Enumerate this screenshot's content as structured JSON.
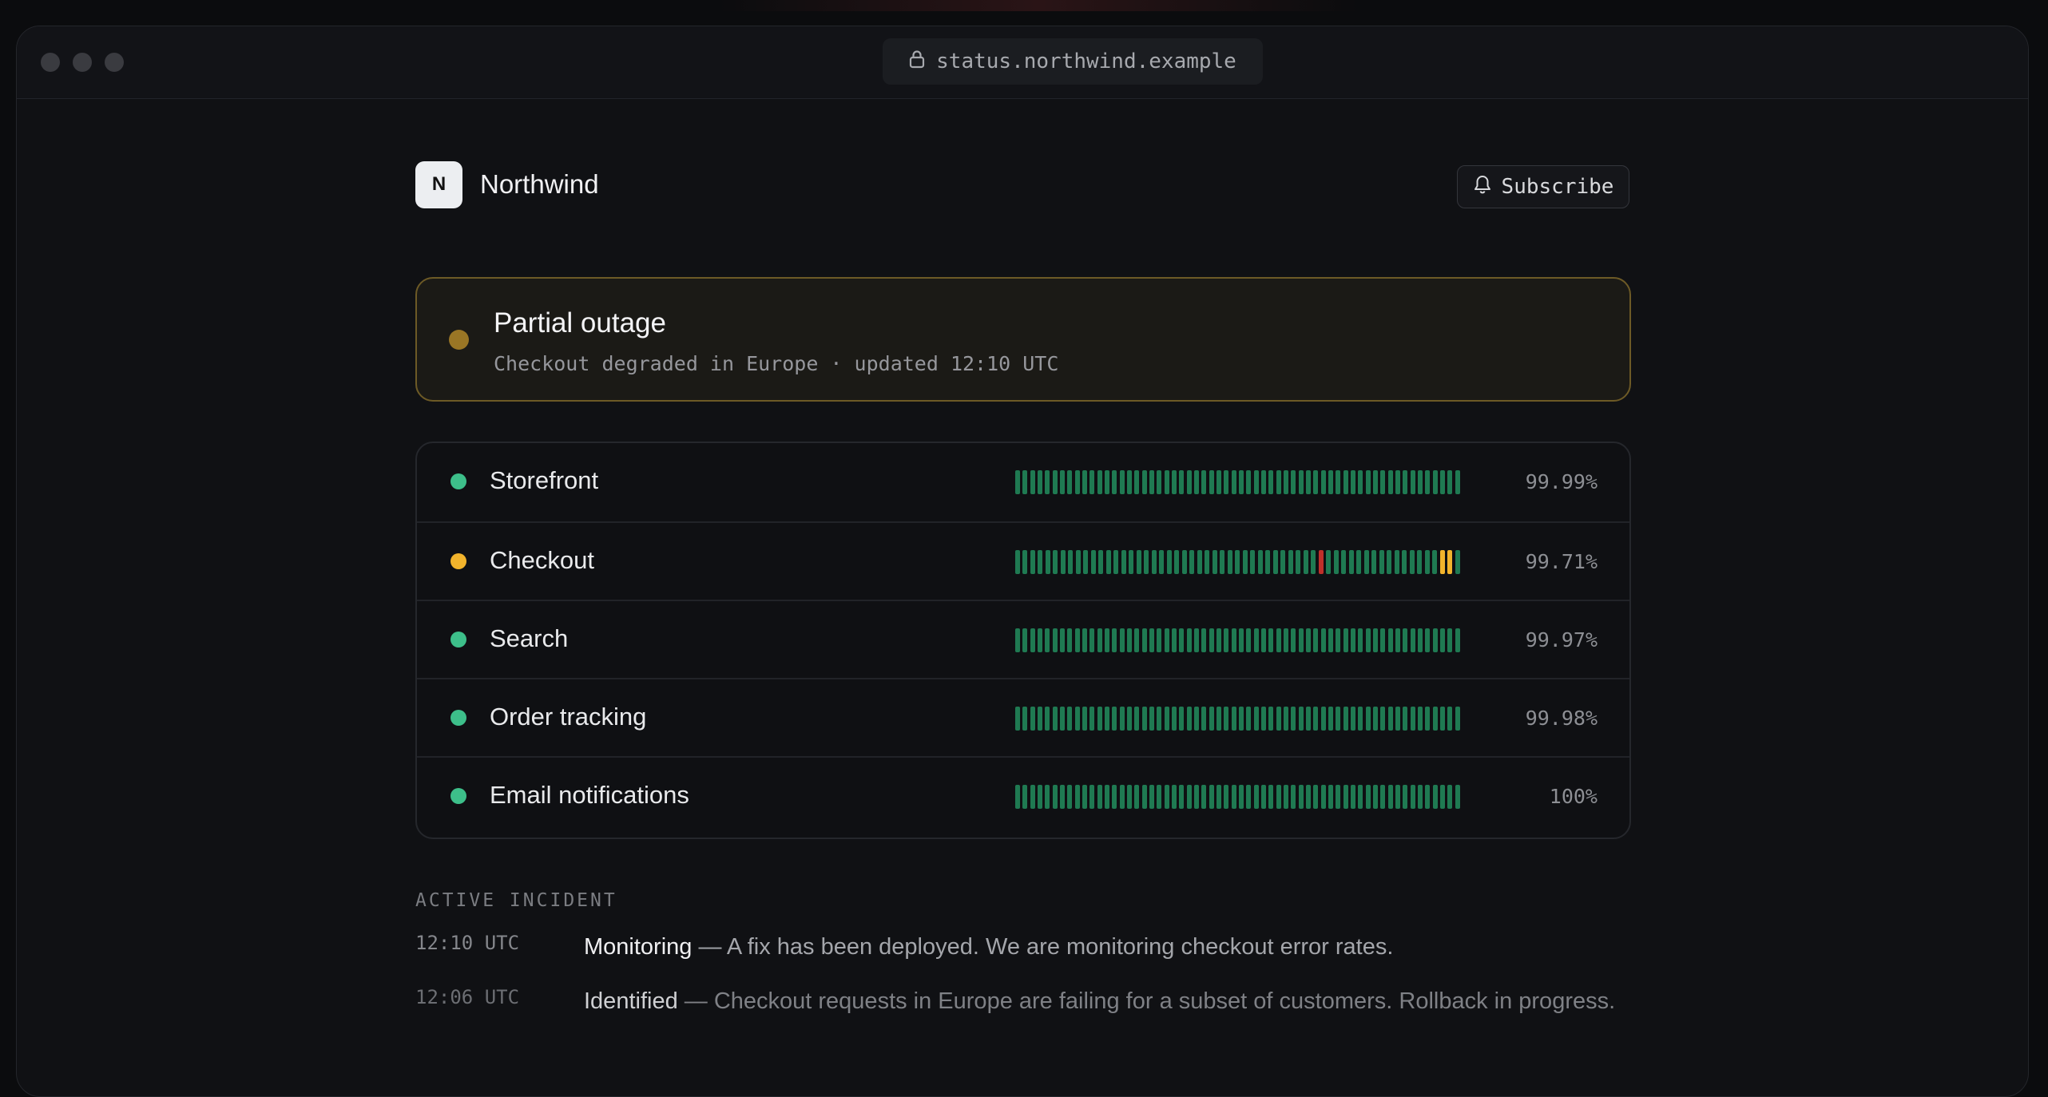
{
  "browser": {
    "url": "status.northwind.example"
  },
  "brand": {
    "logo_letter": "N",
    "name": "Northwind"
  },
  "subscribe_label": "Subscribe",
  "banner": {
    "title": "Partial outage",
    "subtitle": "Checkout degraded in Europe · updated 12:10 UTC",
    "color": "#9a7625"
  },
  "colors": {
    "ok": "#3dbf8a",
    "bar_ok": "#1f7a52",
    "degraded": "#f2b42c",
    "down": "#c0302a"
  },
  "services": [
    {
      "name": "Storefront",
      "status": "ok",
      "uptime": "99.99%",
      "bars": "gggggggggggggggggggggggggggggggggggggggggggggggggggggggggggg"
    },
    {
      "name": "Checkout",
      "status": "degraded",
      "uptime": "99.71%",
      "bars": "ggggggggggggggggggggggggggggggggggggggggrgggggggggggggggyyg"
    },
    {
      "name": "Search",
      "status": "ok",
      "uptime": "99.97%",
      "bars": "gggggggggggggggggggggggggggggggggggggggggggggggggggggggggggg"
    },
    {
      "name": "Order tracking",
      "status": "ok",
      "uptime": "99.98%",
      "bars": "gggggggggggggggggggggggggggggggggggggggggggggggggggggggggggg"
    },
    {
      "name": "Email notifications",
      "status": "ok",
      "uptime": "100%",
      "bars": "gggggggggggggggggggggggggggggggggggggggggggggggggggggggggggg"
    }
  ],
  "incident": {
    "label": "ACTIVE INCIDENT",
    "updates": [
      {
        "time": "12:10 UTC",
        "status": "Monitoring",
        "text": "— A fix has been deployed. We are monitoring checkout error rates."
      },
      {
        "time": "12:06 UTC",
        "status": "Identified",
        "text": "— Checkout requests in Europe are failing for a subset of customers. Rollback in progress."
      }
    ]
  }
}
